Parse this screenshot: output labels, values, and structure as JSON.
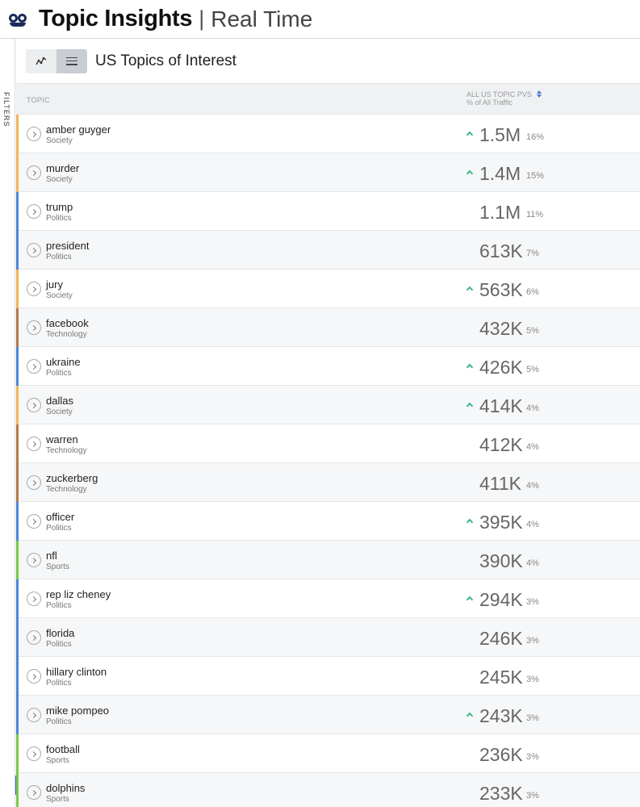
{
  "header": {
    "title": "Topic Insights",
    "separator": "|",
    "subtitle": "Real Time",
    "logo_icon": "eyes-logo-icon"
  },
  "sidebar": {
    "filters_label": "FILTERS"
  },
  "toolbar": {
    "section_title": "US Topics of Interest",
    "views": [
      {
        "icon": "line-chart-icon",
        "active": false
      },
      {
        "icon": "list-icon",
        "active": true
      }
    ]
  },
  "table": {
    "columns": {
      "topic": "TOPIC",
      "pvs": "ALL US TOPIC PVS",
      "pvs_sub": "% of All Traffic"
    },
    "rows": [
      {
        "name": "amber guyger",
        "category": "Society",
        "value": "1.5M",
        "pct": "16%",
        "trending": true
      },
      {
        "name": "murder",
        "category": "Society",
        "value": "1.4M",
        "pct": "15%",
        "trending": true
      },
      {
        "name": "trump",
        "category": "Politics",
        "value": "1.1M",
        "pct": "11%",
        "trending": false
      },
      {
        "name": "president",
        "category": "Politics",
        "value": "613K",
        "pct": "7%",
        "trending": false
      },
      {
        "name": "jury",
        "category": "Society",
        "value": "563K",
        "pct": "6%",
        "trending": true
      },
      {
        "name": "facebook",
        "category": "Technology",
        "value": "432K",
        "pct": "5%",
        "trending": false
      },
      {
        "name": "ukraine",
        "category": "Politics",
        "value": "426K",
        "pct": "5%",
        "trending": true
      },
      {
        "name": "dallas",
        "category": "Society",
        "value": "414K",
        "pct": "4%",
        "trending": true
      },
      {
        "name": "warren",
        "category": "Technology",
        "value": "412K",
        "pct": "4%",
        "trending": false
      },
      {
        "name": "zuckerberg",
        "category": "Technology",
        "value": "411K",
        "pct": "4%",
        "trending": false
      },
      {
        "name": "officer",
        "category": "Politics",
        "value": "395K",
        "pct": "4%",
        "trending": true
      },
      {
        "name": "nfl",
        "category": "Sports",
        "value": "390K",
        "pct": "4%",
        "trending": false
      },
      {
        "name": "rep liz cheney",
        "category": "Politics",
        "value": "294K",
        "pct": "3%",
        "trending": true
      },
      {
        "name": "florida",
        "category": "Politics",
        "value": "246K",
        "pct": "3%",
        "trending": false
      },
      {
        "name": "hillary clinton",
        "category": "Politics",
        "value": "245K",
        "pct": "3%",
        "trending": false
      },
      {
        "name": "mike pompeo",
        "category": "Politics",
        "value": "243K",
        "pct": "3%",
        "trending": true
      },
      {
        "name": "football",
        "category": "Sports",
        "value": "236K",
        "pct": "3%",
        "trending": false
      },
      {
        "name": "dolphins",
        "category": "Sports",
        "value": "233K",
        "pct": "3%",
        "trending": false
      }
    ]
  },
  "category_colors": {
    "Society": "#f0b45c",
    "Politics": "#4a86d8",
    "Technology": "#b07a4a",
    "Sports": "#7cc84a"
  },
  "colors": {
    "trend_up": "#3cb58f",
    "accent": "#2b6de0"
  }
}
